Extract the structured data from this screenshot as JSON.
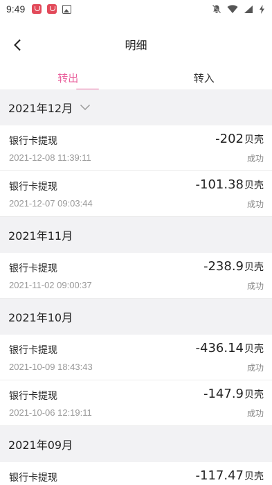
{
  "status_bar": {
    "time": "9:49"
  },
  "header": {
    "title": "明细"
  },
  "tabs": [
    {
      "label": "转出",
      "active": true
    },
    {
      "label": "转入",
      "active": false
    }
  ],
  "unit": "贝壳",
  "months": [
    {
      "label": "2021年12月",
      "records": [
        {
          "title": "银行卡提现",
          "time": "2021-12-08 11:39:11",
          "amount": "-202",
          "status": "成功"
        },
        {
          "title": "银行卡提现",
          "time": "2021-12-07 09:03:44",
          "amount": "-101.38",
          "status": "成功"
        }
      ]
    },
    {
      "label": "2021年11月",
      "records": [
        {
          "title": "银行卡提现",
          "time": "2021-11-02 09:00:37",
          "amount": "-238.9",
          "status": "成功"
        }
      ]
    },
    {
      "label": "2021年10月",
      "records": [
        {
          "title": "银行卡提现",
          "time": "2021-10-09 18:43:43",
          "amount": "-436.14",
          "status": "成功"
        },
        {
          "title": "银行卡提现",
          "time": "2021-10-06 12:19:11",
          "amount": "-147.9",
          "status": "成功"
        }
      ]
    },
    {
      "label": "2021年09月",
      "records": [
        {
          "title": "银行卡提现",
          "time": "",
          "amount": "-117.47",
          "status": ""
        }
      ]
    }
  ],
  "colors": {
    "accent": "#e9609c",
    "section_bg": "#f2f2f4",
    "muted_text": "#999999"
  }
}
